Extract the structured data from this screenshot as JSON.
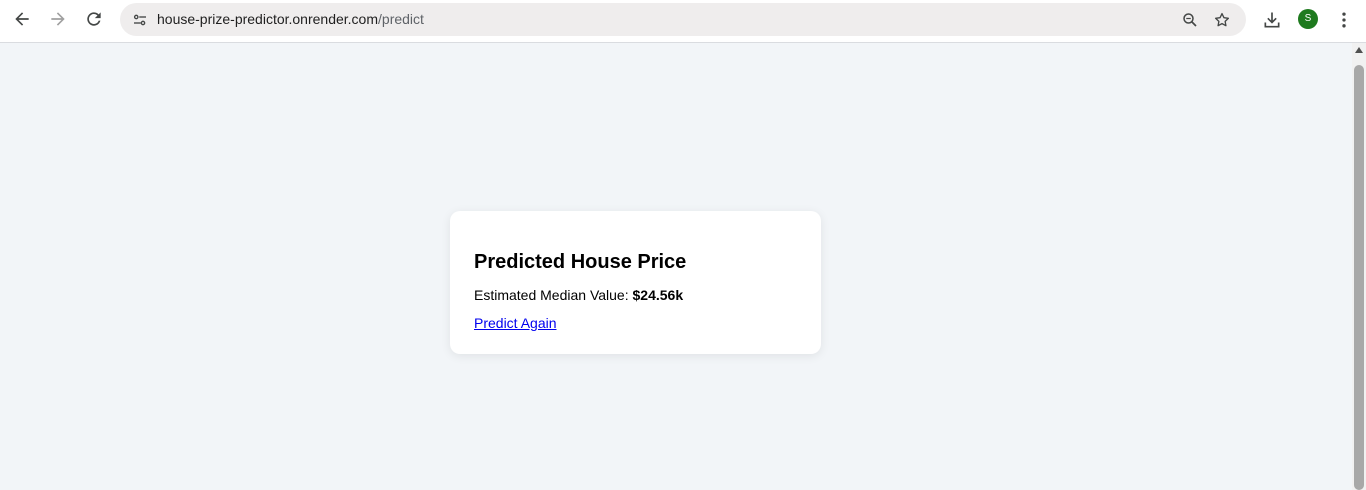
{
  "browser": {
    "url_host": "house-prize-predictor.onrender.com",
    "url_path": "/predict",
    "profile_initial": "S",
    "icons": [
      "back-arrow-icon",
      "forward-arrow-icon",
      "reload-icon",
      "site-info-icon",
      "zoom-icon",
      "bookmark-star-icon",
      "download-icon",
      "more-vert-icon"
    ]
  },
  "card": {
    "title": "Predicted House Price",
    "estimate_label": "Estimated Median Value: ",
    "estimate_value": "$24.56k",
    "link_label": "Predict Again"
  },
  "colors": {
    "page_bg": "#f2f5f8",
    "card_bg": "#ffffff",
    "link": "#0000ee",
    "avatar": "#1e7a1e"
  }
}
